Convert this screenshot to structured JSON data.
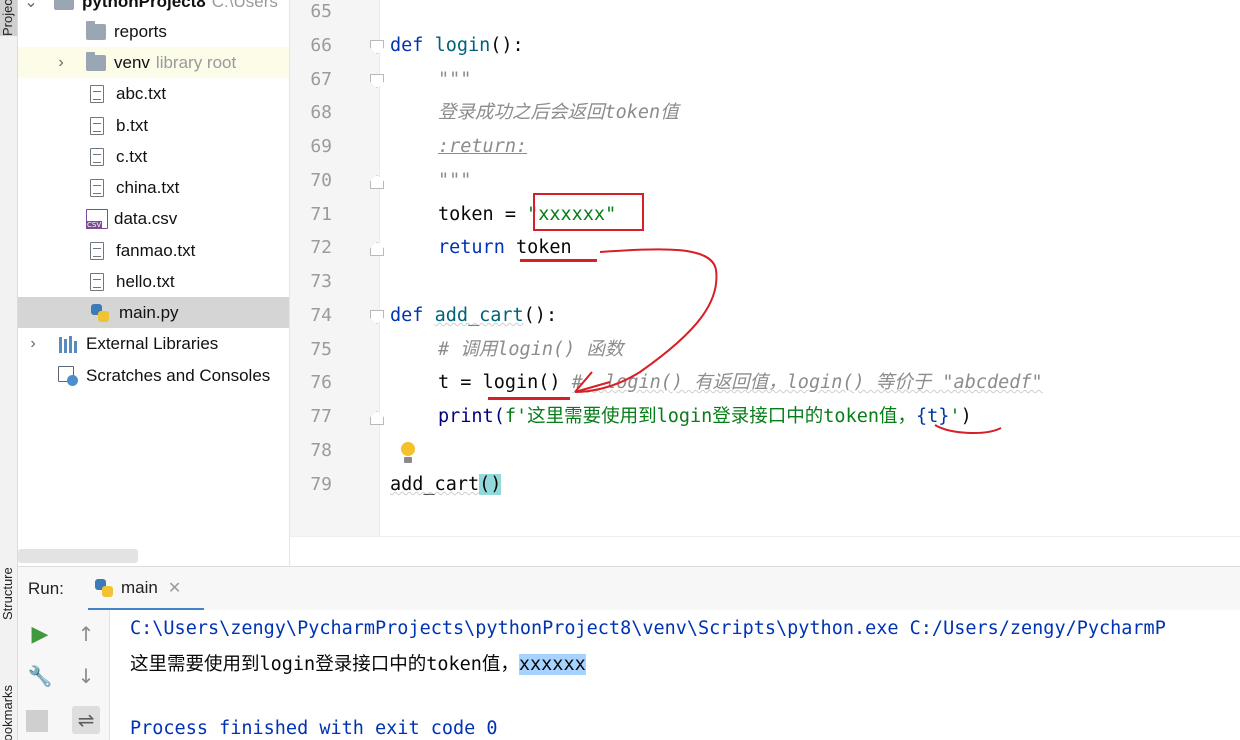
{
  "left_strip": {
    "project_tab": "Project",
    "structure_tab": "Structure",
    "bookmarks_tab": "Bookmarks"
  },
  "project_tree": {
    "root_name": "pythonProject8",
    "root_path": "C:\\Users",
    "items": [
      {
        "label": "reports",
        "type": "folder"
      },
      {
        "label": "venv",
        "suffix": "library root",
        "type": "folder"
      },
      {
        "label": "abc.txt",
        "type": "txt"
      },
      {
        "label": "b.txt",
        "type": "txt"
      },
      {
        "label": "c.txt",
        "type": "txt"
      },
      {
        "label": "china.txt",
        "type": "txt"
      },
      {
        "label": "data.csv",
        "type": "csv"
      },
      {
        "label": "fanmao.txt",
        "type": "txt"
      },
      {
        "label": "hello.txt",
        "type": "txt"
      },
      {
        "label": "main.py",
        "type": "py"
      }
    ],
    "external_libraries": "External Libraries",
    "scratches": "Scratches and Consoles"
  },
  "editor": {
    "line_numbers": [
      "65",
      "66",
      "67",
      "68",
      "69",
      "70",
      "71",
      "72",
      "73",
      "74",
      "75",
      "76",
      "77",
      "78",
      "79"
    ],
    "code": {
      "l66_def": "def",
      "l66_name": "login",
      "l66_rest": "():",
      "l67": "\"\"\"",
      "l68": "登录成功之后会返回token值",
      "l69": ":return:",
      "l70": "\"\"\"",
      "l71_var": "token = ",
      "l71_str": "\"xxxxxx\"",
      "l72_kw": "return",
      "l72_rest": " token",
      "l74_def": "def",
      "l74_name": "add_cart",
      "l74_rest": "():",
      "l75": "# 调用login() 函数",
      "l76_code": "t = login() ",
      "l76_comment": "#  login() 有返回值，login() 等价于 \"abcdedf\"",
      "l77_print": "print(",
      "l77_fstr_a": "f'这里需要使用到login登录接口中的token值，",
      "l77_braces": "{t}",
      "l77_fstr_b": "'",
      "l77_close": ")",
      "l79_call": "add_cart",
      "l79_parens": "()"
    }
  },
  "run_panel": {
    "label": "Run:",
    "tab_label": "main",
    "console": {
      "command": "C:\\Users\\zengy\\PycharmProjects\\pythonProject8\\venv\\Scripts\\python.exe C:/Users/zengy/PycharmP",
      "output_prefix": "这里需要使用到login登录接口中的token值，",
      "output_value": "xxxxxx",
      "exit_message": "Process finished with exit code 0"
    }
  },
  "colors": {
    "keyword": "#0033b3",
    "function": "#00627a",
    "string": "#067d17",
    "comment": "#8c8c8c",
    "annotation_red": "#d61f26",
    "selection": "#a6d2ff"
  }
}
